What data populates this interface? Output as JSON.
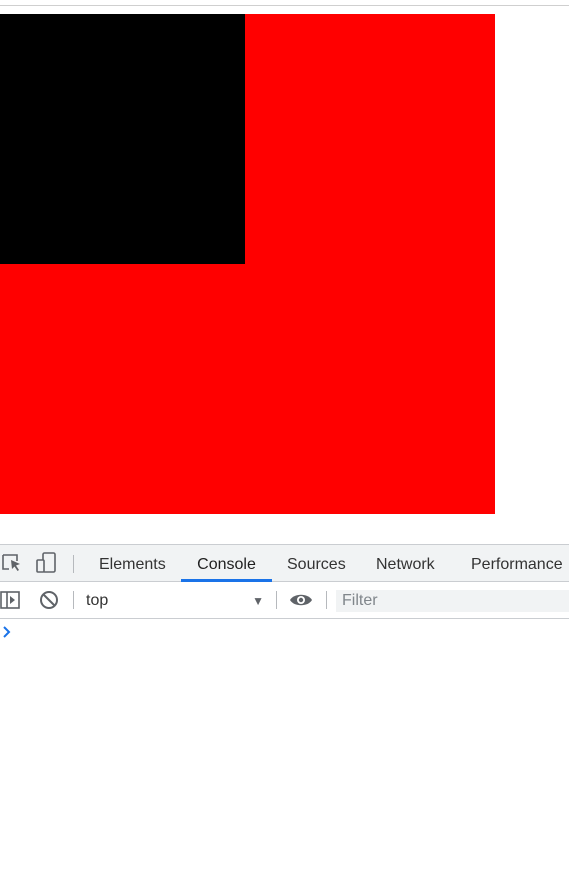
{
  "page": {
    "red_box_color": "#ff0000",
    "black_box_color": "#000000"
  },
  "devtools": {
    "tabs": [
      {
        "label": "Elements",
        "active": false
      },
      {
        "label": "Console",
        "active": true
      },
      {
        "label": "Sources",
        "active": false
      },
      {
        "label": "Network",
        "active": false
      },
      {
        "label": "Performance",
        "active": false
      }
    ],
    "toolbar": {
      "context_value": "top",
      "filter_placeholder": "Filter"
    },
    "icons": [
      "inspect-element-icon",
      "device-toolbar-icon",
      "sidebar-toggle-icon",
      "clear-console-icon",
      "live-expression-eye-icon",
      "console-prompt-icon"
    ],
    "accent_color": "#1a73e8"
  }
}
